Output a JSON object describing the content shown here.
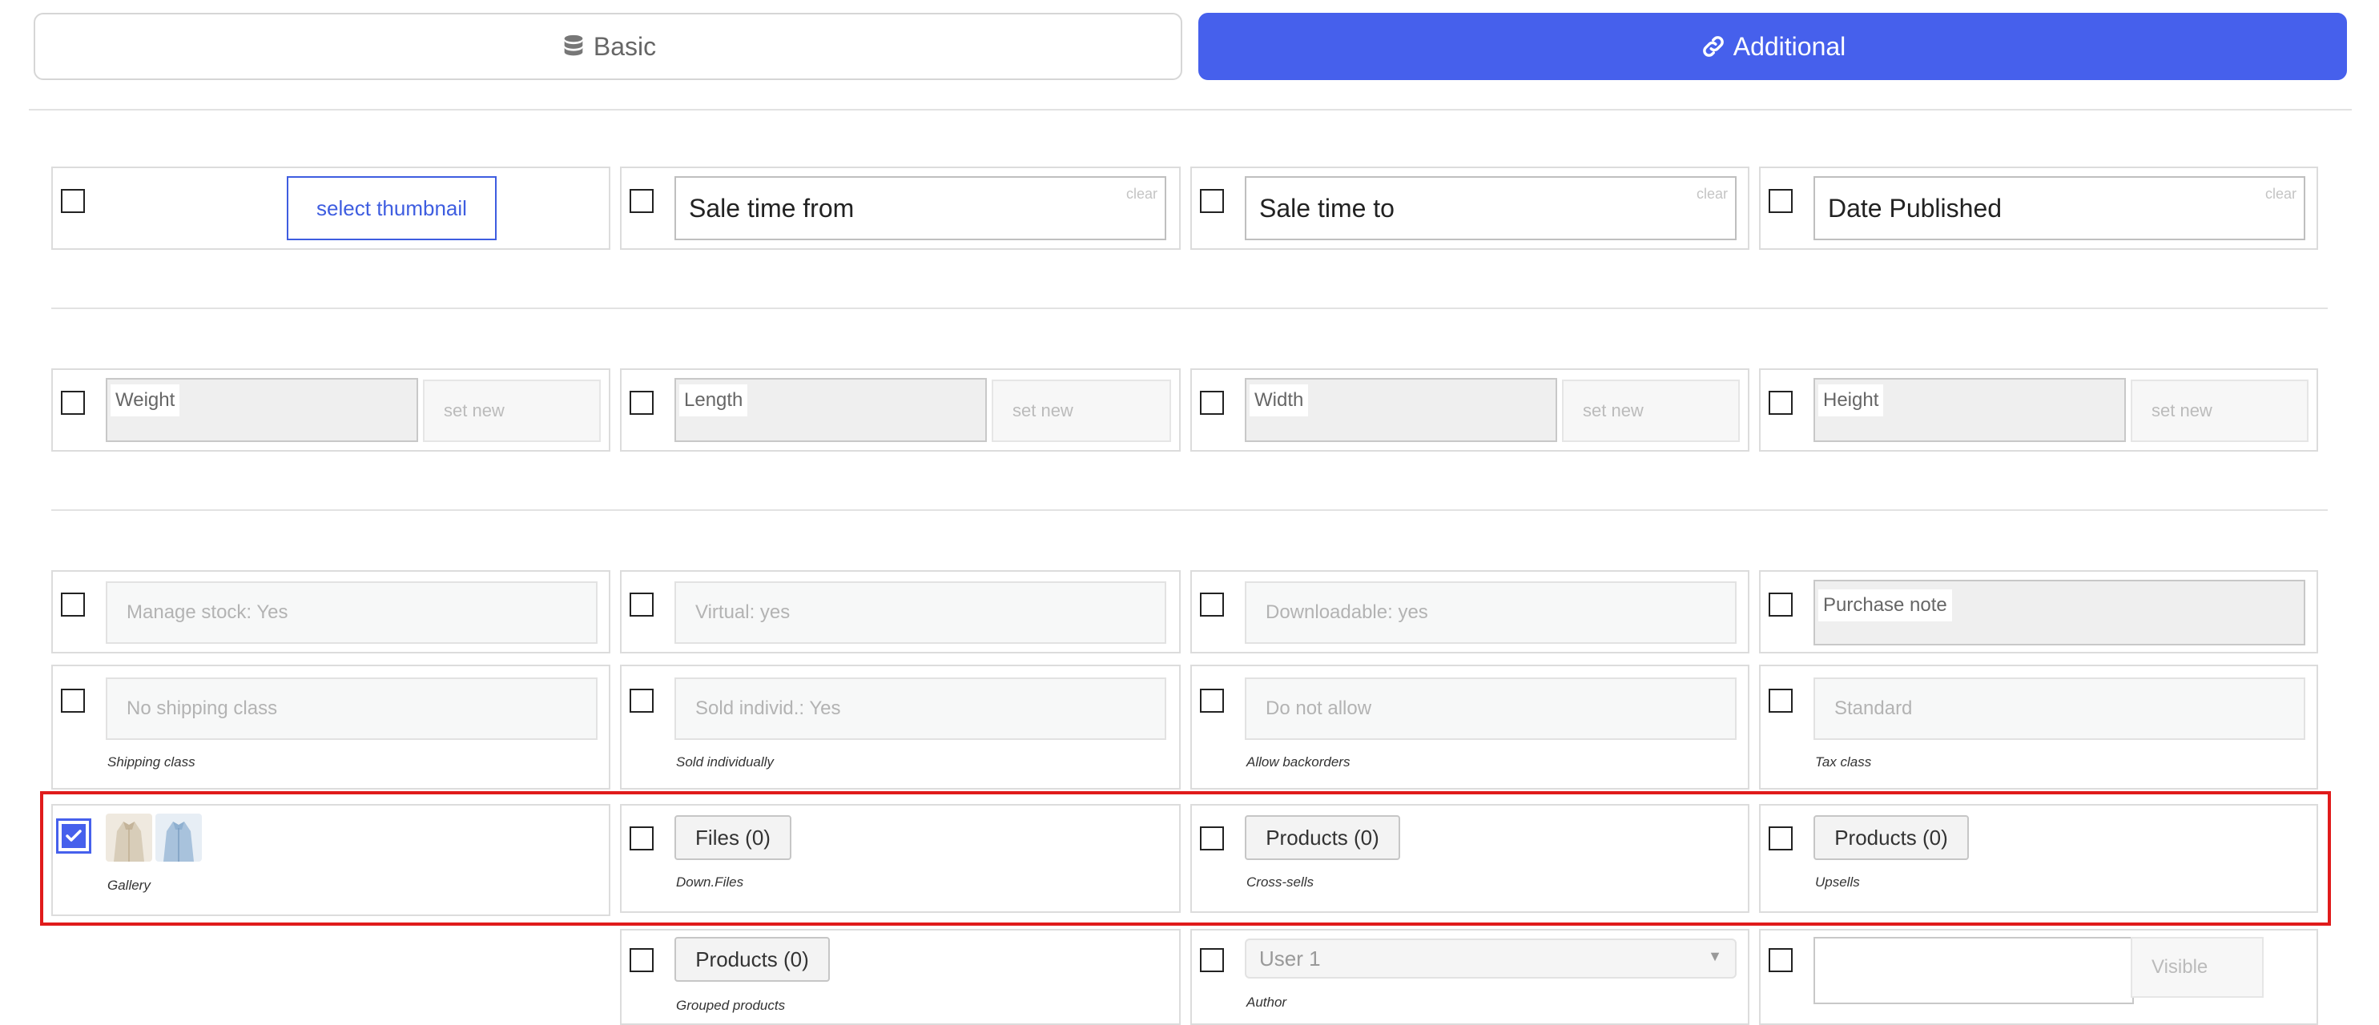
{
  "tabs": {
    "basic": "Basic",
    "additional": "Additional"
  },
  "row1": {
    "thumbnail_button": "select thumbnail",
    "sale_from": "Sale time from",
    "sale_to": "Sale time to",
    "date_published": "Date Published",
    "clear": "clear"
  },
  "row2": {
    "weight": "Weight",
    "length": "Length",
    "width": "Width",
    "height": "Height",
    "set_new": "set new"
  },
  "row3": {
    "manage_stock": "Manage stock: Yes",
    "virtual": "Virtual: yes",
    "downloadable": "Downloadable: yes",
    "purchase_note": "Purchase note"
  },
  "row4": {
    "shipping_value": "No shipping class",
    "shipping_caption": "Shipping class",
    "sold_value": "Sold individ.: Yes",
    "sold_caption": "Sold individually",
    "backorders_value": "Do not allow",
    "backorders_caption": "Allow backorders",
    "tax_value": "Standard",
    "tax_caption": "Tax class"
  },
  "row5": {
    "gallery_caption": "Gallery",
    "files_button": "Files (0)",
    "files_caption": "Down.Files",
    "crosssells_button": "Products (0)",
    "crosssells_caption": "Cross-sells",
    "upsells_button": "Products (0)",
    "upsells_caption": "Upsells"
  },
  "row6": {
    "grouped_button": "Products (0)",
    "grouped_caption": "Grouped products",
    "author_value": "User 1",
    "author_caption": "Author",
    "visible_label": "Visible"
  },
  "colors": {
    "accent": "#4660ec",
    "highlight": "#e01b1b"
  }
}
